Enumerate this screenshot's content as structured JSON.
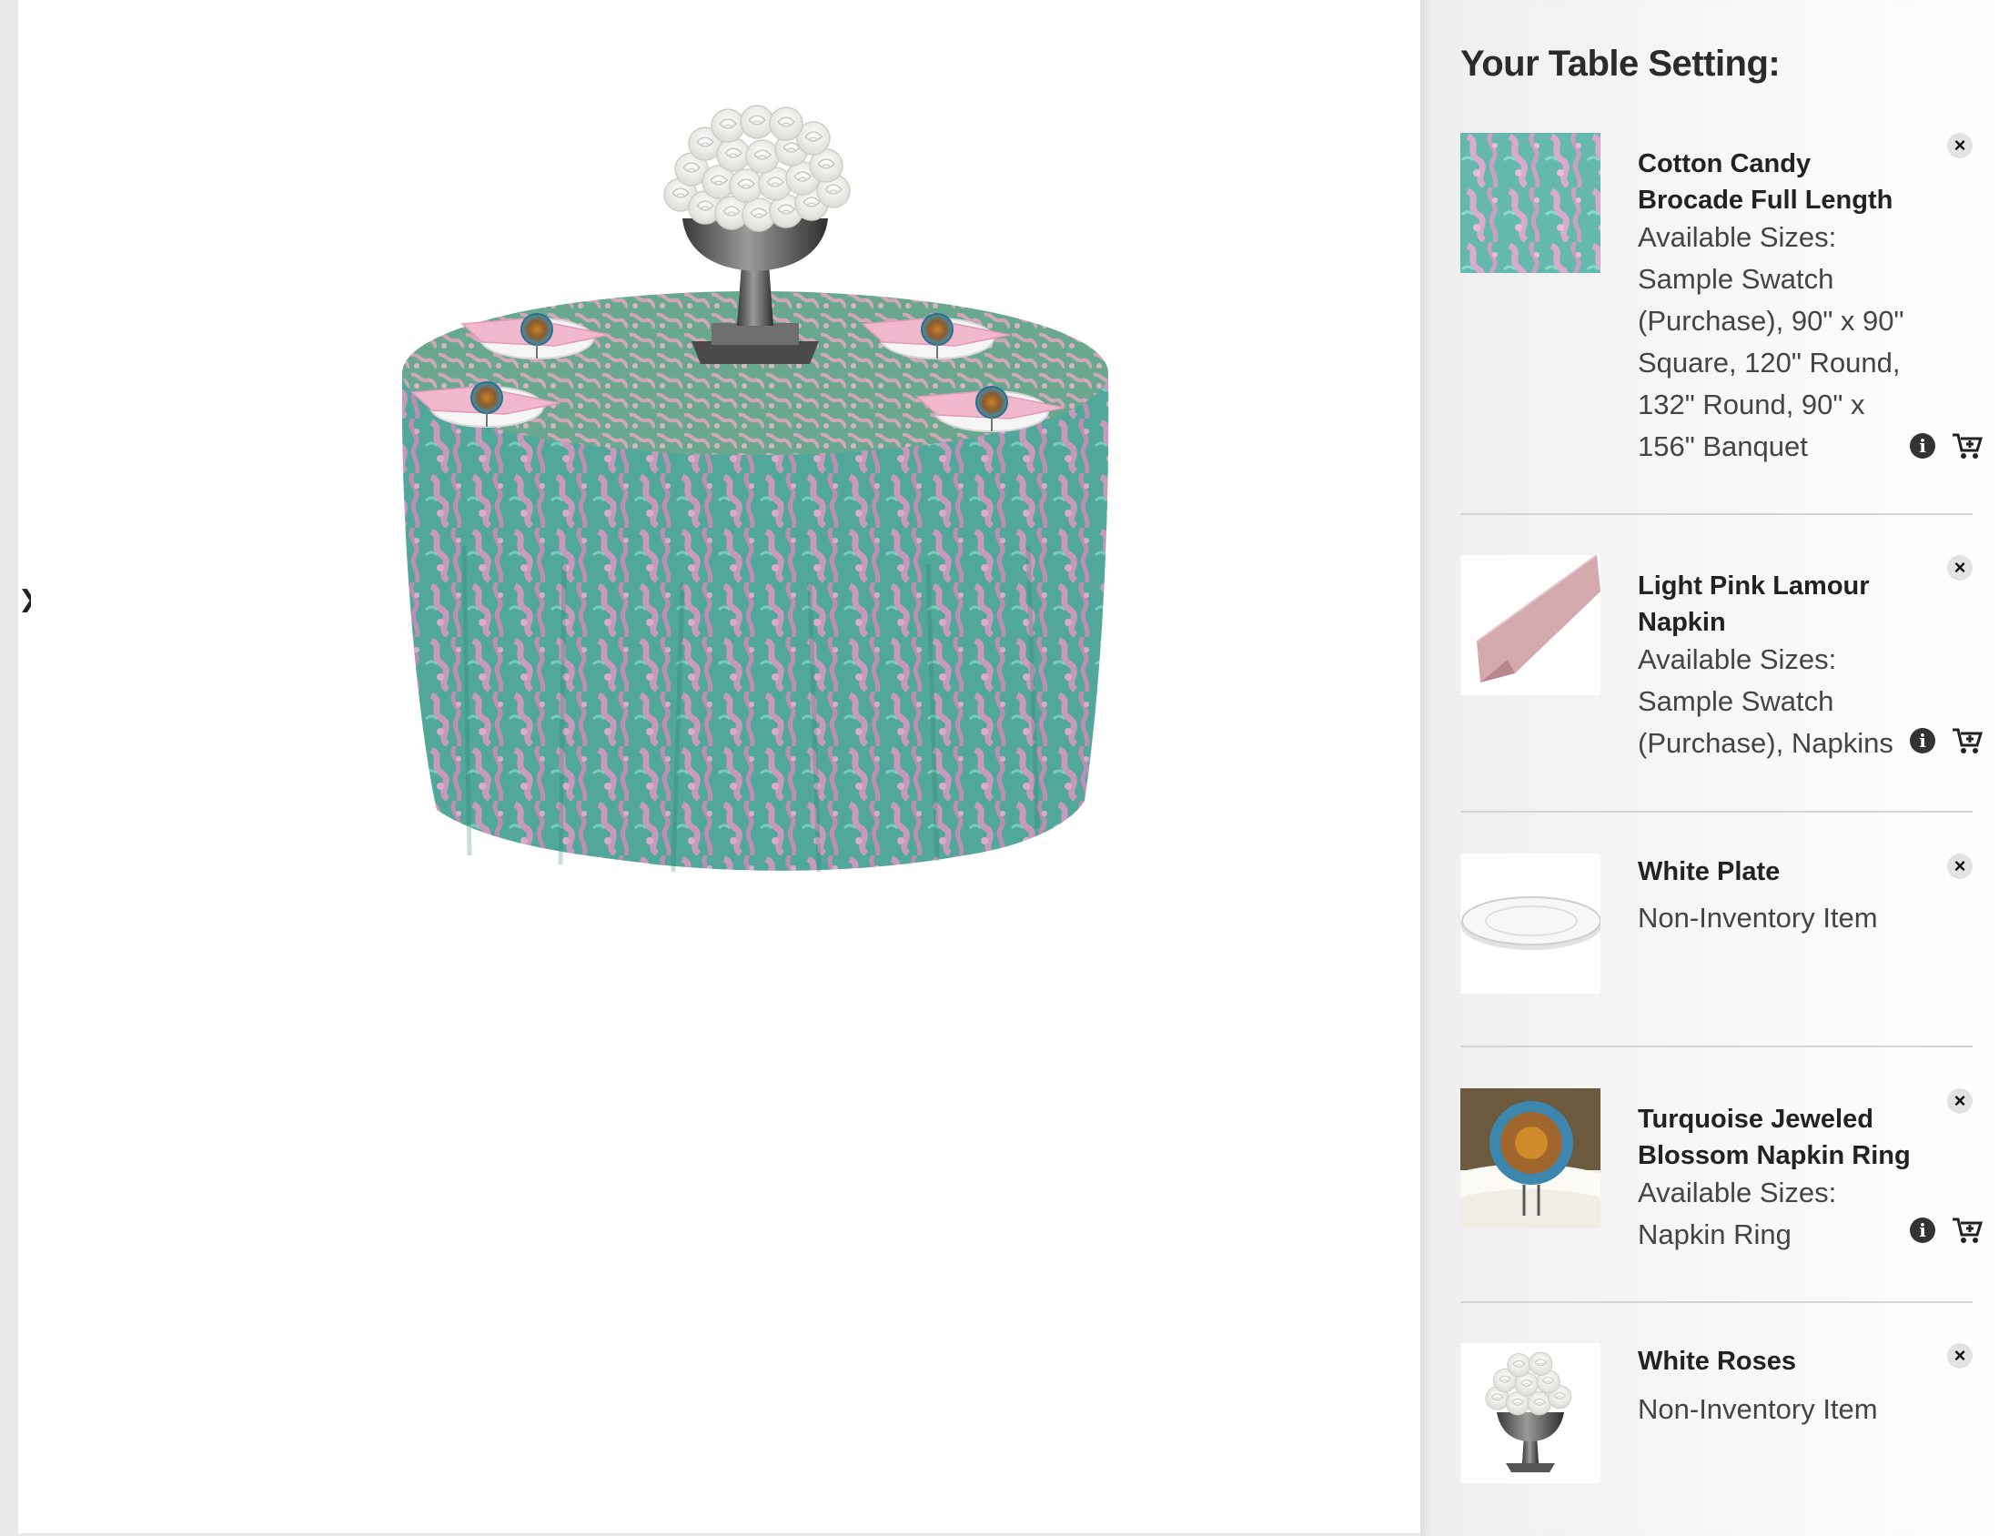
{
  "sidebar": {
    "title": "Your Table Setting:",
    "items": [
      {
        "name": "Cotton Candy Brocade Full Length",
        "sizes_label": "Available Sizes:",
        "sizes": "Sample Swatch (Purchase), 90\" x 90\" Square, 120\" Round, 132\" Round, 90\" x 156\" Banquet",
        "thumb_icon": "brocade-swatch"
      },
      {
        "name": "Light Pink Lamour Napkin",
        "sizes_label": "Available Sizes:",
        "sizes": "Sample Swatch (Purchase), Napkins",
        "thumb_icon": "napkin"
      },
      {
        "name": "White Plate",
        "note": "Non-Inventory Item",
        "thumb_icon": "plate"
      },
      {
        "name": "Turquoise Jeweled Blossom Napkin Ring",
        "sizes_label": "Available Sizes:",
        "sizes": "Napkin Ring",
        "thumb_icon": "napkin-ring"
      },
      {
        "name": "White Roses",
        "note": "Non-Inventory Item",
        "thumb_icon": "rose-centerpiece"
      }
    ]
  },
  "icons": {
    "remove": "close-icon",
    "info": "info-icon",
    "cart": "add-to-cart-icon"
  },
  "colors": {
    "tablecloth_teal": "#5fb3a7",
    "tablecloth_pink": "#d9a6c9",
    "napkin_pink": "#f0b8cf"
  }
}
